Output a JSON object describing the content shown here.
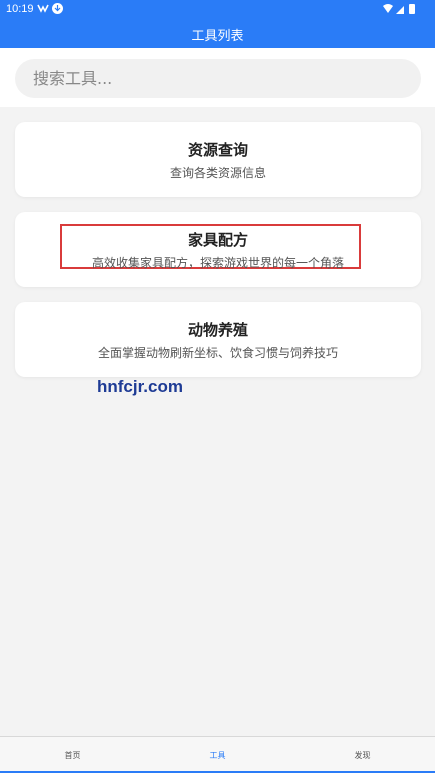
{
  "status_bar": {
    "time": "10:19"
  },
  "header": {
    "title": "工具列表"
  },
  "search": {
    "placeholder": "搜索工具..."
  },
  "cards": [
    {
      "title": "资源查询",
      "description": "查询各类资源信息"
    },
    {
      "title": "家具配方",
      "description": "高效收集家具配方，探索游戏世界的每一个角落",
      "highlighted": true
    },
    {
      "title": "动物养殖",
      "description": "全面掌握动物刷新坐标、饮食习惯与饲养技巧"
    }
  ],
  "watermark": "hnfcjr.com",
  "tabs": [
    {
      "label": "首页",
      "active": false
    },
    {
      "label": "工具",
      "active": true
    },
    {
      "label": "发现",
      "active": false
    }
  ],
  "colors": {
    "primary": "#2a7cf7",
    "highlight": "#d93b3b",
    "watermark": "#1e3b95"
  }
}
